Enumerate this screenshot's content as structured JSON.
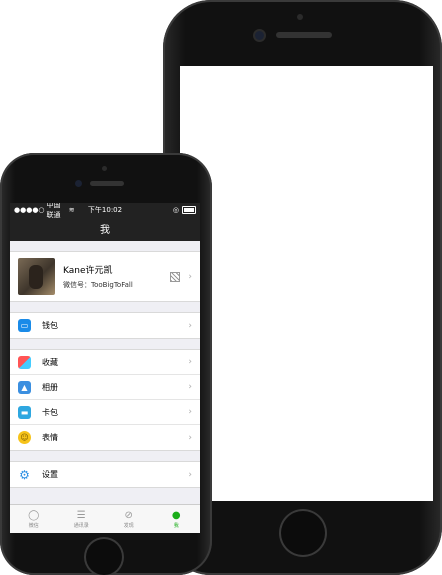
{
  "status": {
    "carrier": "中国联通",
    "time": "下午10:02"
  },
  "nav": {
    "title": "我"
  },
  "profile": {
    "name": "Kane许元凯",
    "wechat_id": "微信号：TooBigToFall"
  },
  "menu": {
    "wallet": "钱包",
    "favorites": "收藏",
    "album": "相册",
    "cards": "卡包",
    "stickers": "表情",
    "settings": "设置"
  },
  "tabs": [
    "微信",
    "通讯录",
    "发现",
    "我"
  ],
  "colors": {
    "accent": "#1aad19",
    "nav_bg": "#222222"
  }
}
